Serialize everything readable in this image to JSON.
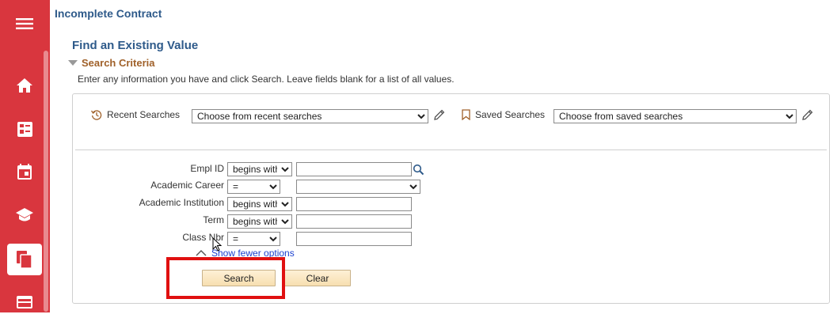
{
  "sidebar": {
    "items": [
      {
        "icon": "hamburger-menu-icon"
      },
      {
        "icon": "home-icon"
      },
      {
        "icon": "dashboard-card-icon"
      },
      {
        "icon": "calendar-icon"
      },
      {
        "icon": "graduation-cap-icon"
      },
      {
        "icon": "documents-icon",
        "active": true
      },
      {
        "icon": "credit-card-icon"
      }
    ]
  },
  "header": {
    "title": "Incomplete Contract"
  },
  "search": {
    "find_title": "Find an Existing Value",
    "criteria_label": "Search Criteria",
    "instructions": "Enter any information you have and click Search. Leave fields blank for a list of all values.",
    "recent_label": "Recent Searches",
    "recent_selected": "Choose from recent searches",
    "saved_label": "Saved Searches",
    "saved_selected": "Choose from saved searches",
    "fields": {
      "empl_id": {
        "label": "Empl ID",
        "operator": "begins with",
        "value": ""
      },
      "academic_career": {
        "label": "Academic Career",
        "operator": "=",
        "value": ""
      },
      "academic_institution": {
        "label": "Academic Institution",
        "operator": "begins with",
        "value": ""
      },
      "term": {
        "label": "Term",
        "operator": "begins with",
        "value": ""
      },
      "class_nbr": {
        "label": "Class Nbr",
        "operator": "=",
        "value": ""
      }
    },
    "fewer_options": "Show fewer options",
    "search_button": "Search",
    "clear_button": "Clear"
  },
  "colors": {
    "sidebar": "#d9363e",
    "title_blue": "#2e5a8a",
    "criteria_brown": "#a0612a",
    "highlight": "#e01010"
  }
}
